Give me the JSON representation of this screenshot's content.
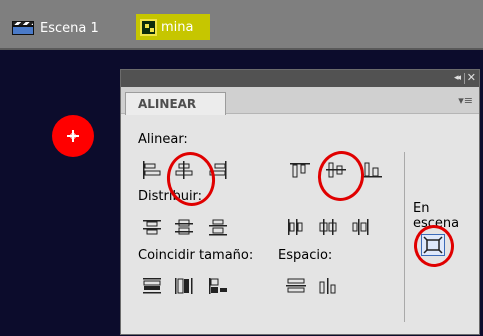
{
  "breadcrumb": {
    "scene_label": "Escena 1",
    "symbol_label": "mina"
  },
  "panel": {
    "tab_label": "ALINEAR",
    "align_label": "Alinear:",
    "distribute_label": "Distribuir:",
    "match_size_label": "Coincidir tamaño:",
    "space_label": "Espacio:",
    "stage_label_line1": "En",
    "stage_label_line2": "escena",
    "collapse_glyph": "◂◂",
    "close_glyph": "✕",
    "menu_glyph": "▾≡"
  },
  "colors": {
    "stage_bg": "#0c0c2c",
    "symbol_highlight": "#c6c600",
    "annotation_red": "#e00000",
    "object_red": "#ff0000"
  },
  "icons": {
    "align": [
      "align-left-edge-icon",
      "align-horizontal-center-icon",
      "align-right-edge-icon",
      "align-top-edge-icon",
      "align-vertical-center-icon",
      "align-bottom-edge-icon"
    ],
    "distribute": [
      "distribute-top-icon",
      "distribute-vertical-center-icon",
      "distribute-bottom-icon",
      "distribute-left-icon",
      "distribute-horizontal-center-icon",
      "distribute-right-icon"
    ],
    "match_size": [
      "match-width-icon",
      "match-height-icon",
      "match-width-height-icon"
    ],
    "space": [
      "space-vertical-icon",
      "space-horizontal-icon"
    ],
    "stage": "align-to-stage-icon"
  }
}
